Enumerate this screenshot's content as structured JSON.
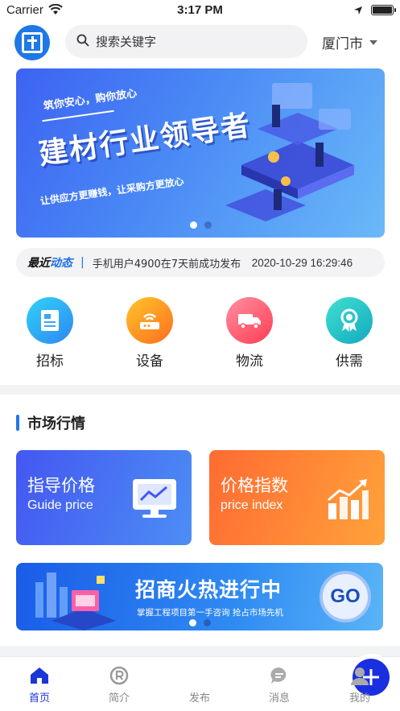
{
  "status_bar": {
    "carrier": "Carrier",
    "time": "3:17 PM"
  },
  "header": {
    "search_placeholder": "搜索关键字",
    "city": "厦门市"
  },
  "banner": {
    "tagline": "筑你安心，购你放心",
    "headline": "建材行业领导者",
    "subline": "让供应方更赚钱，让采购方更放心",
    "slides": 2,
    "active_slide": 1
  },
  "news": {
    "tag_part1": "最近",
    "tag_part2": "动态",
    "message": "手机用户4900在7天前成功发布",
    "time": "2020-10-29 16:29:46"
  },
  "quick_actions": [
    {
      "label": "招标",
      "icon": "document-icon",
      "color": "#3aa8f5"
    },
    {
      "label": "设备",
      "icon": "router-icon",
      "color": "#ff9a1e"
    },
    {
      "label": "物流",
      "icon": "truck-icon",
      "color": "#ff5a6a"
    },
    {
      "label": "供需",
      "icon": "award-icon",
      "color": "#26c3c8"
    }
  ],
  "market": {
    "title": "市场行情",
    "cards": [
      {
        "cn": "指导价格",
        "en": "Guide price"
      },
      {
        "cn": "价格指数",
        "en": "price index"
      }
    ],
    "promo": {
      "title": "招商火热进行中",
      "subtitle": "掌握工程项目第一手咨询  抢占市场先机",
      "badge": "GO",
      "slides": 2,
      "active_slide": 1
    }
  },
  "tabbar": {
    "items": [
      {
        "label": "首页",
        "icon": "home-icon"
      },
      {
        "label": "简介",
        "icon": "r-circle-icon"
      },
      {
        "label": "发布",
        "icon": "plus-icon"
      },
      {
        "label": "消息",
        "icon": "chat-icon"
      },
      {
        "label": "我的",
        "icon": "user-icon"
      }
    ],
    "active": "首页"
  }
}
